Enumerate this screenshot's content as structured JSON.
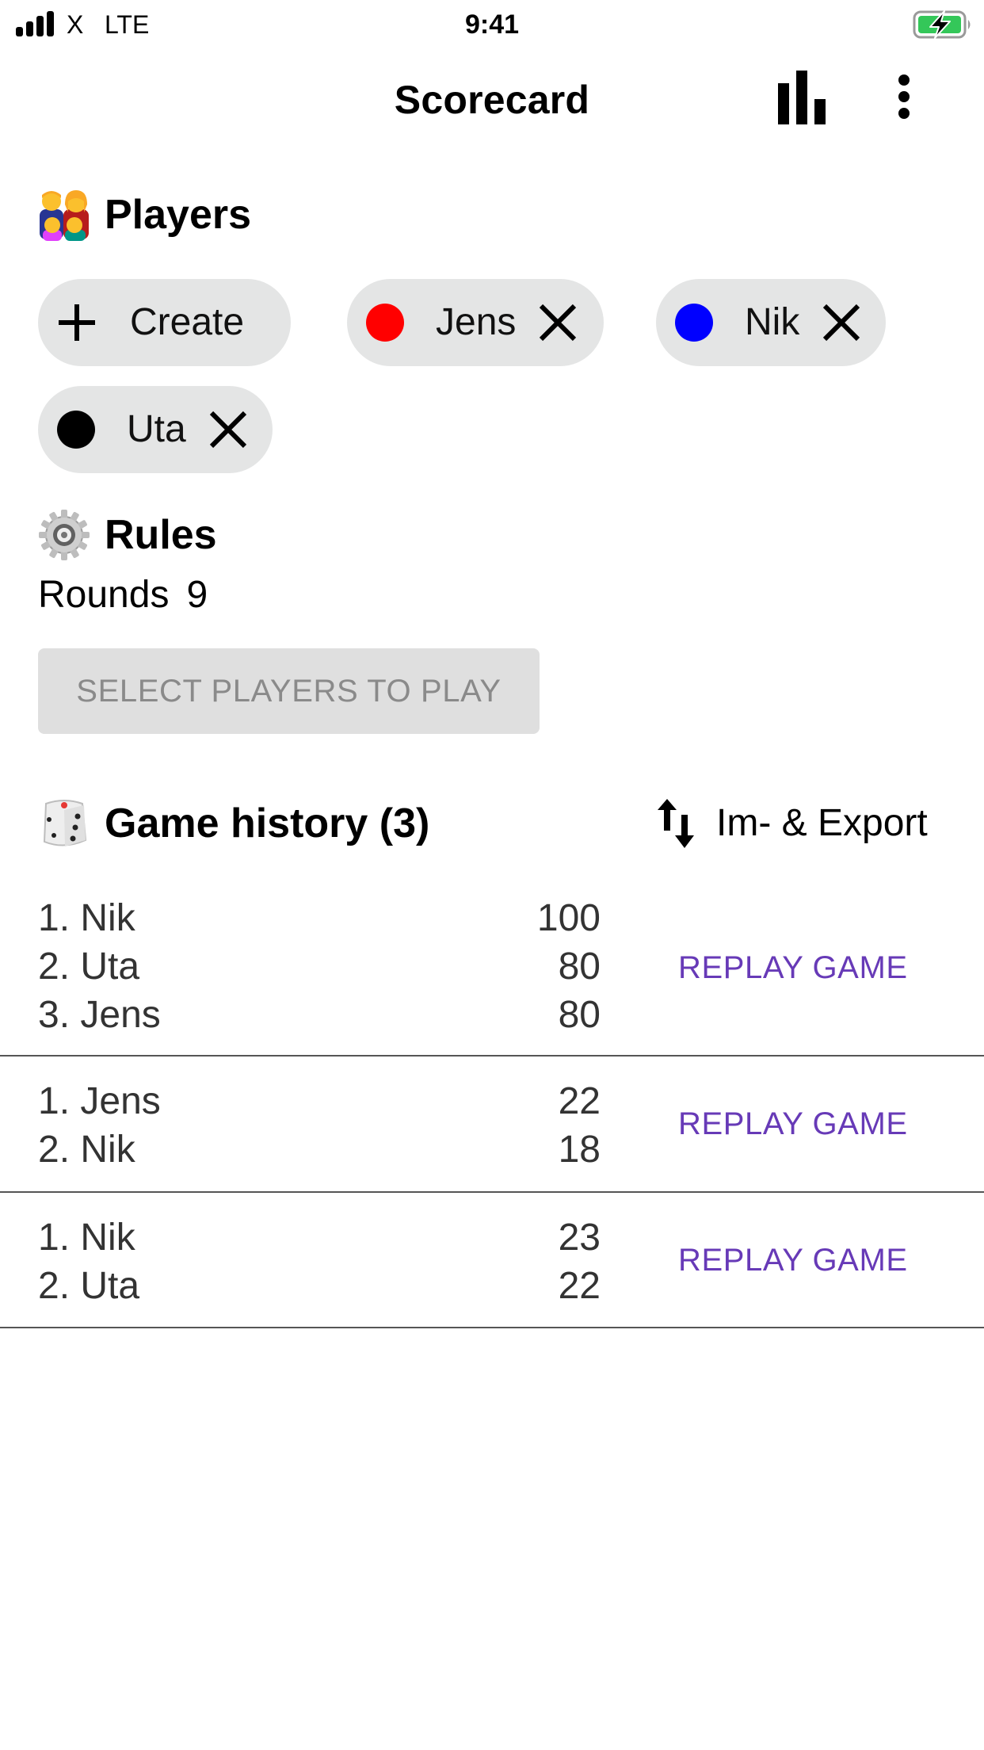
{
  "status_bar": {
    "carrier": "X",
    "network": "LTE",
    "time": "9:41",
    "signal_bars": 4,
    "battery_state": "charging",
    "battery_color": "#34c759"
  },
  "app_bar": {
    "title": "Scorecard",
    "actions": [
      {
        "name": "statistics",
        "icon": "bar-chart-icon"
      },
      {
        "name": "more-options",
        "icon": "more-vert-icon"
      }
    ]
  },
  "players_section": {
    "emoji": "👪",
    "title": "Players",
    "create_label": "Create",
    "players": [
      {
        "name": "Jens",
        "color": "#ff0000"
      },
      {
        "name": "Nik",
        "color": "#0000ff"
      },
      {
        "name": "Uta",
        "color": "#000000"
      }
    ]
  },
  "rules_section": {
    "emoji": "⚙️",
    "title": "Rules",
    "rounds_label": "Rounds",
    "rounds_value": "9"
  },
  "play_button": {
    "label": "SELECT PLAYERS TO PLAY",
    "enabled": false
  },
  "history_section": {
    "emoji": "🎲",
    "title": "Game history (3)",
    "import_export_label": "Im- & Export",
    "replay_label": "REPLAY GAME",
    "accent_color": "#673ab7",
    "games": [
      {
        "results": [
          {
            "rank": "1. Nik",
            "score": "100"
          },
          {
            "rank": "2. Uta",
            "score": "80"
          },
          {
            "rank": "3. Jens",
            "score": "80"
          }
        ]
      },
      {
        "results": [
          {
            "rank": "1. Jens",
            "score": "22"
          },
          {
            "rank": "2. Nik",
            "score": "18"
          }
        ]
      },
      {
        "results": [
          {
            "rank": "1. Nik",
            "score": "23"
          },
          {
            "rank": "2. Uta",
            "score": "22"
          }
        ]
      }
    ]
  }
}
